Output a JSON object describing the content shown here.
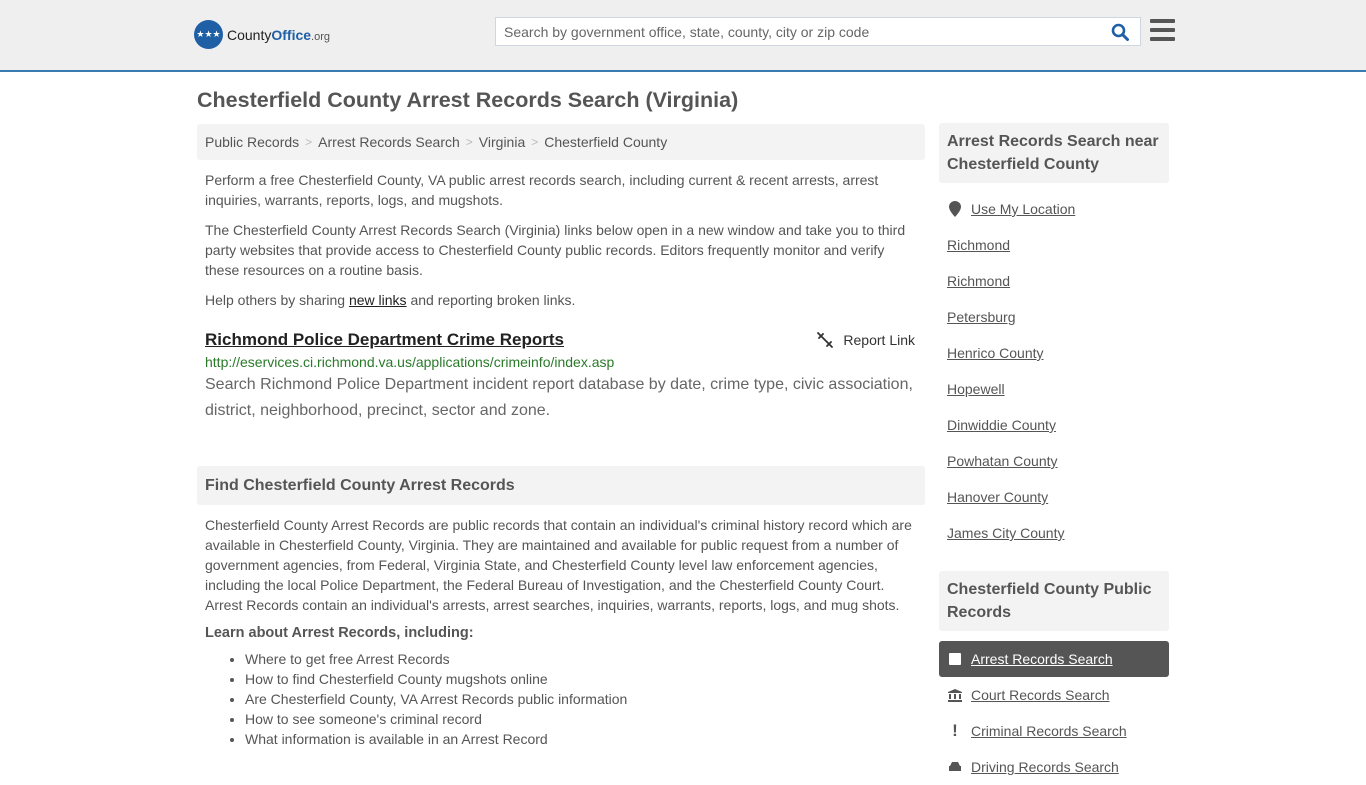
{
  "header": {
    "logo_main": "County",
    "logo_brand": "Office",
    "logo_tld": ".org",
    "search_placeholder": "Search by government office, state, county, city or zip code",
    "search_value": ""
  },
  "page_title": "Chesterfield County Arrest Records Search (Virginia)",
  "breadcrumb": [
    "Public Records",
    "Arrest Records Search",
    "Virginia",
    "Chesterfield County"
  ],
  "intro": {
    "p1": "Perform a free Chesterfield County, VA public arrest records search, including current & recent arrests, arrest inquiries, warrants, reports, logs, and mugshots.",
    "p2": "The Chesterfield County Arrest Records Search (Virginia) links below open in a new window and take you to third party websites that provide access to Chesterfield County public records. Editors frequently monitor and verify these resources on a routine basis.",
    "p3_before": "Help others by sharing ",
    "p3_link": "new links",
    "p3_after": " and reporting broken links."
  },
  "resource": {
    "title": "Richmond Police Department Crime Reports",
    "report_label": "Report Link",
    "url": "http://eservices.ci.richmond.va.us/applications/crimeinfo/index.asp",
    "description": "Search Richmond Police Department incident report database by date, crime type, civic association, district, neighborhood, precinct, sector and zone."
  },
  "find_section": {
    "title": "Find Chesterfield County Arrest Records",
    "body": "Chesterfield County Arrest Records are public records that contain an individual's criminal history record which are available in Chesterfield County, Virginia. They are maintained and available for public request from a number of government agencies, from Federal, Virginia State, and Chesterfield County level law enforcement agencies, including the local Police Department, the Federal Bureau of Investigation, and the Chesterfield County Court. Arrest Records contain an individual's arrests, arrest searches, inquiries, warrants, reports, logs, and mug shots.",
    "learn_title": "Learn about Arrest Records, including:",
    "learn_items": [
      "Where to get free Arrest Records",
      "How to find Chesterfield County mugshots online",
      "Are Chesterfield County, VA Arrest Records public information",
      "How to see someone's criminal record",
      "What information is available in an Arrest Record"
    ]
  },
  "sidebar": {
    "nearby_title": "Arrest Records Search near Chesterfield County",
    "use_location": "Use My Location",
    "nearby": [
      "Richmond",
      "Richmond",
      "Petersburg",
      "Henrico County",
      "Hopewell",
      "Dinwiddie County",
      "Powhatan County",
      "Hanover County",
      "James City County"
    ],
    "public_title": "Chesterfield County Public Records",
    "public_items": [
      {
        "label": "Arrest Records Search",
        "icon": "square-icon",
        "active": true
      },
      {
        "label": "Court Records Search",
        "icon": "courthouse-icon",
        "active": false
      },
      {
        "label": "Criminal Records Search",
        "icon": "exclamation-icon",
        "active": false
      },
      {
        "label": "Driving Records Search",
        "icon": "car-icon",
        "active": false
      }
    ]
  },
  "colors": {
    "brand_blue": "#1f5fa5",
    "header_border": "#3a7bb0",
    "url_green": "#2a7a2a",
    "active_bg": "#555555"
  }
}
